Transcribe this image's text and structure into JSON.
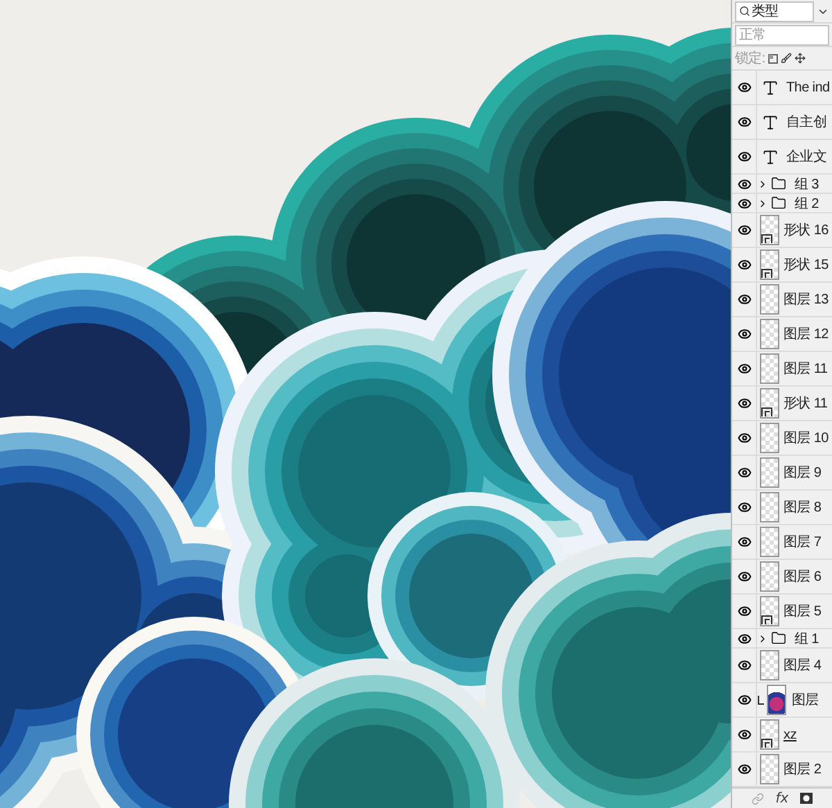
{
  "layers_panel": {
    "filter": {
      "value": "类型"
    },
    "blend_mode": {
      "value": "正常"
    },
    "lock": {
      "label": "锁定:"
    },
    "layers": [
      {
        "kind": "text",
        "name": "The ind",
        "visible": true
      },
      {
        "kind": "text",
        "name": "自主创",
        "visible": true
      },
      {
        "kind": "text",
        "name": "企业文",
        "visible": true
      },
      {
        "kind": "group",
        "name": "组 3",
        "visible": true,
        "expanded": false
      },
      {
        "kind": "group",
        "name": "组 2",
        "visible": true,
        "expanded": false
      },
      {
        "kind": "shape",
        "name": "形状 16",
        "visible": true
      },
      {
        "kind": "shape",
        "name": "形状 15",
        "visible": true
      },
      {
        "kind": "pixel",
        "name": "图层 13",
        "visible": true
      },
      {
        "kind": "pixel",
        "name": "图层 12",
        "visible": true
      },
      {
        "kind": "pixel",
        "name": "图层 11",
        "visible": true
      },
      {
        "kind": "shape",
        "name": "形状 11",
        "visible": true
      },
      {
        "kind": "pixel",
        "name": "图层 10",
        "visible": true
      },
      {
        "kind": "pixel",
        "name": "图层 9",
        "visible": true
      },
      {
        "kind": "pixel",
        "name": "图层 8",
        "visible": true
      },
      {
        "kind": "pixel",
        "name": "图层 7",
        "visible": true
      },
      {
        "kind": "pixel",
        "name": "图层 6",
        "visible": true
      },
      {
        "kind": "shape",
        "name": "图层 5",
        "visible": true
      },
      {
        "kind": "group",
        "name": "组 1",
        "visible": true,
        "expanded": false
      },
      {
        "kind": "pixel",
        "name": "图层 4",
        "visible": true
      },
      {
        "kind": "clipped",
        "name": "图层",
        "visible": true
      },
      {
        "kind": "shape",
        "name": "xz",
        "visible": true
      },
      {
        "kind": "pixel",
        "name": "图层 2",
        "visible": true
      }
    ],
    "footer": {
      "fx": "fx"
    }
  }
}
